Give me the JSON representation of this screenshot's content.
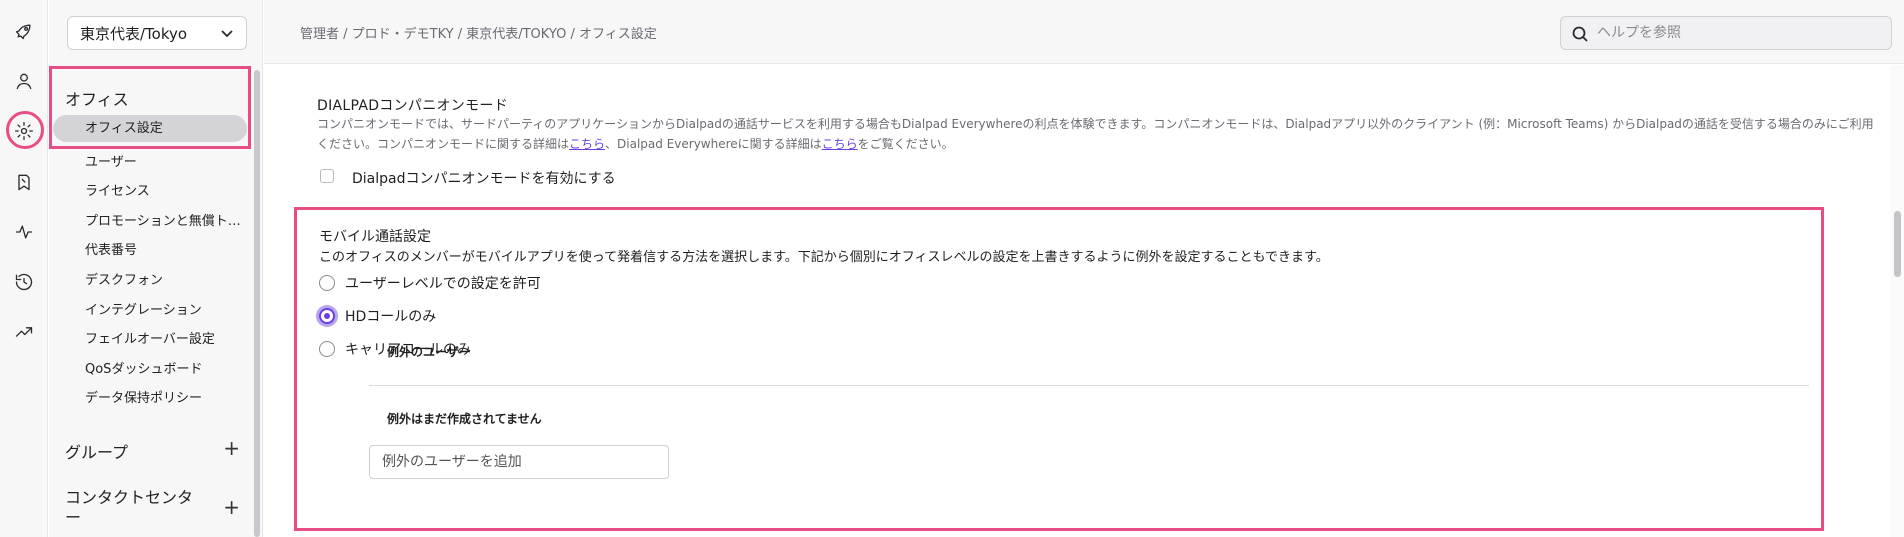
{
  "rail": {
    "icons": [
      "rocket-icon",
      "user-icon",
      "gear-icon",
      "bookmark-icon",
      "activity-icon",
      "history-icon",
      "trending-icon"
    ]
  },
  "sidebar": {
    "office_select": "東京代表/Tokyo",
    "office_heading": "オフィス",
    "items": [
      {
        "label": "オフィス設定",
        "active": true
      },
      {
        "label": "ユーザー"
      },
      {
        "label": "ライセンス"
      },
      {
        "label": "プロモーションと無償トラ..."
      },
      {
        "label": "代表番号"
      },
      {
        "label": "デスクフォン"
      },
      {
        "label": "インテグレーション"
      },
      {
        "label": "フェイルオーバー設定"
      },
      {
        "label": "QoSダッシュボード"
      },
      {
        "label": "データ保持ポリシー"
      }
    ],
    "groups_heading": "グループ",
    "contact_center_heading": "コンタクトセンター"
  },
  "header": {
    "breadcrumb": "管理者 / プロド・デモTKY / 東京代表/TOKYO / オフィス設定",
    "search_placeholder": "ヘルプを参照"
  },
  "companion": {
    "title": "DIALPADコンパニオンモード",
    "desc_line1": "コンパニオンモードでは、サードパーティのアプリケーションからDialpadの通話サービスを利用する場合もDialpad Everywhereの利点を体験できます。コンパニオンモードは、Dialpadアプリ以外のクライアント (例：Microsoft Teams) からDialpadの通話を受信する場合のみにご利用",
    "desc_line2_a": "ください。コンパニオンモードに関する詳細は",
    "link1": "こちら",
    "desc_line2_b": "、Dialpad Everywhereに関する詳細は",
    "link2": "こちら",
    "desc_line2_c": "をご覧ください。",
    "checkbox_label": "Dialpadコンパニオンモードを有効にする"
  },
  "mobile": {
    "title": "モバイル通話設定",
    "desc": "このオフィスのメンバーがモバイルアプリを使って発着信する方法を選択します。下記から個別にオフィスレベルの設定を上書きするように例外を設定することもできます。",
    "options": [
      {
        "label": "ユーザーレベルでの設定を許可",
        "checked": false
      },
      {
        "label": "HDコールのみ",
        "checked": true
      },
      {
        "label": "キャリアコールのみ",
        "checked": false
      }
    ],
    "exceptions_heading": "例外のユーザー",
    "exceptions_empty": "例外はまだ作成されてません",
    "add_exception_placeholder": "例外のユーザーを追加"
  },
  "colors": {
    "highlight": "#e84c85",
    "accent": "#6b3fe0"
  }
}
